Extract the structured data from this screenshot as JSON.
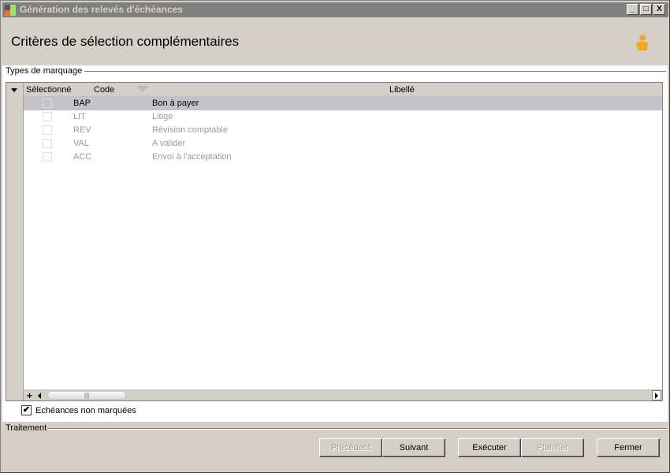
{
  "window": {
    "title": "Génération des relevés d'échéances",
    "controls": [
      "_",
      "□",
      "X"
    ]
  },
  "heading": "Critères de sélection complémentaires",
  "group1": {
    "label": "Types de marquage"
  },
  "grid": {
    "columns": {
      "selected": "Sélectionné",
      "code": "Code",
      "label": "Libellé"
    },
    "rows": [
      {
        "code": "BAP",
        "label": "Bon à payer",
        "checked": false,
        "selected": true
      },
      {
        "code": "LIT",
        "label": "Litige",
        "checked": false,
        "selected": false
      },
      {
        "code": "REV",
        "label": "Révision comptable",
        "checked": false,
        "selected": false
      },
      {
        "code": "VAL",
        "label": "A valider",
        "checked": false,
        "selected": false
      },
      {
        "code": "ACC",
        "label": "Envoi à l'acceptation",
        "checked": false,
        "selected": false
      }
    ],
    "add": "+",
    "thumb": "|||"
  },
  "unmarked": {
    "label": "Echéances non marquées",
    "checked": true,
    "mark": "✔"
  },
  "group2": {
    "label": "Traitement"
  },
  "buttons": {
    "prev": "Précédent",
    "next": "Suivant",
    "execute": "Exécuter",
    "schedule": "Planifier",
    "close": "Fermer"
  },
  "colors": {
    "titlebar": "#808080",
    "accent": "#f5a623"
  }
}
